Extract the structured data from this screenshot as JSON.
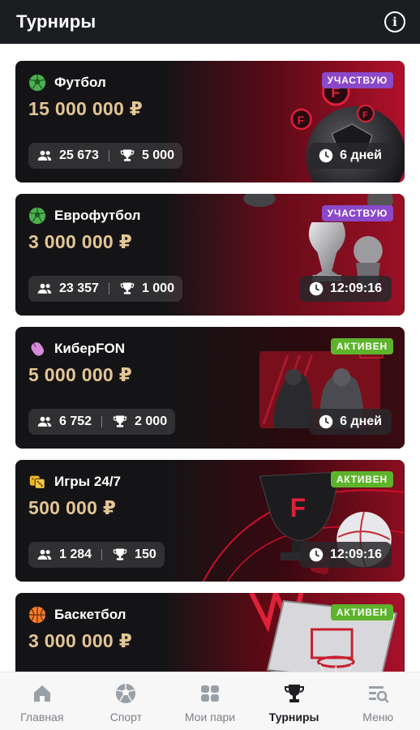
{
  "header": {
    "title": "Турниры",
    "info_icon": "info-icon"
  },
  "colors": {
    "header_bg": "#1b1d21",
    "card_bg": "#141416",
    "prize_gold": "#e3c594",
    "badge_participating": "#8b48c8",
    "badge_active": "#5eb32c",
    "accent_red": "#c8102e"
  },
  "tournaments": [
    {
      "sport": "Футбол",
      "sport_icon": "soccer-ball-icon",
      "prize": "15 000 000 ₽",
      "status": "УЧАСТВУЮ",
      "status_color": "purple",
      "participants": "25 673",
      "prizes": "5 000",
      "time": "6 дней"
    },
    {
      "sport": "Еврофутбол",
      "sport_icon": "soccer-ball-icon",
      "prize": "3 000 000 ₽",
      "status": "УЧАСТВУЮ",
      "status_color": "purple",
      "participants": "23 357",
      "prizes": "1 000",
      "time": "12:09:16"
    },
    {
      "sport": "КиберFON",
      "sport_icon": "mouse-icon",
      "prize": "5 000 000 ₽",
      "status": "АКТИВЕН",
      "status_color": "green",
      "participants": "6 752",
      "prizes": "2 000",
      "time": "6 дней"
    },
    {
      "sport": "Игры 24/7",
      "sport_icon": "dice-icon",
      "prize": "500 000 ₽",
      "status": "АКТИВЕН",
      "status_color": "green",
      "participants": "1 284",
      "prizes": "150",
      "time": "12:09:16"
    },
    {
      "sport": "Баскетбол",
      "sport_icon": "basketball-icon",
      "prize": "3 000 000 ₽",
      "status": "АКТИВЕН",
      "status_color": "green",
      "participants": "",
      "prizes": "",
      "time": ""
    }
  ],
  "tabbar": [
    {
      "label": "Главная",
      "icon": "home-icon",
      "active": false
    },
    {
      "label": "Спорт",
      "icon": "soccer-ball-icon",
      "active": false
    },
    {
      "label": "Мои пари",
      "icon": "bets-icon",
      "active": false
    },
    {
      "label": "Турниры",
      "icon": "trophy-icon",
      "active": true
    },
    {
      "label": "Меню",
      "icon": "menu-search-icon",
      "active": false
    }
  ]
}
